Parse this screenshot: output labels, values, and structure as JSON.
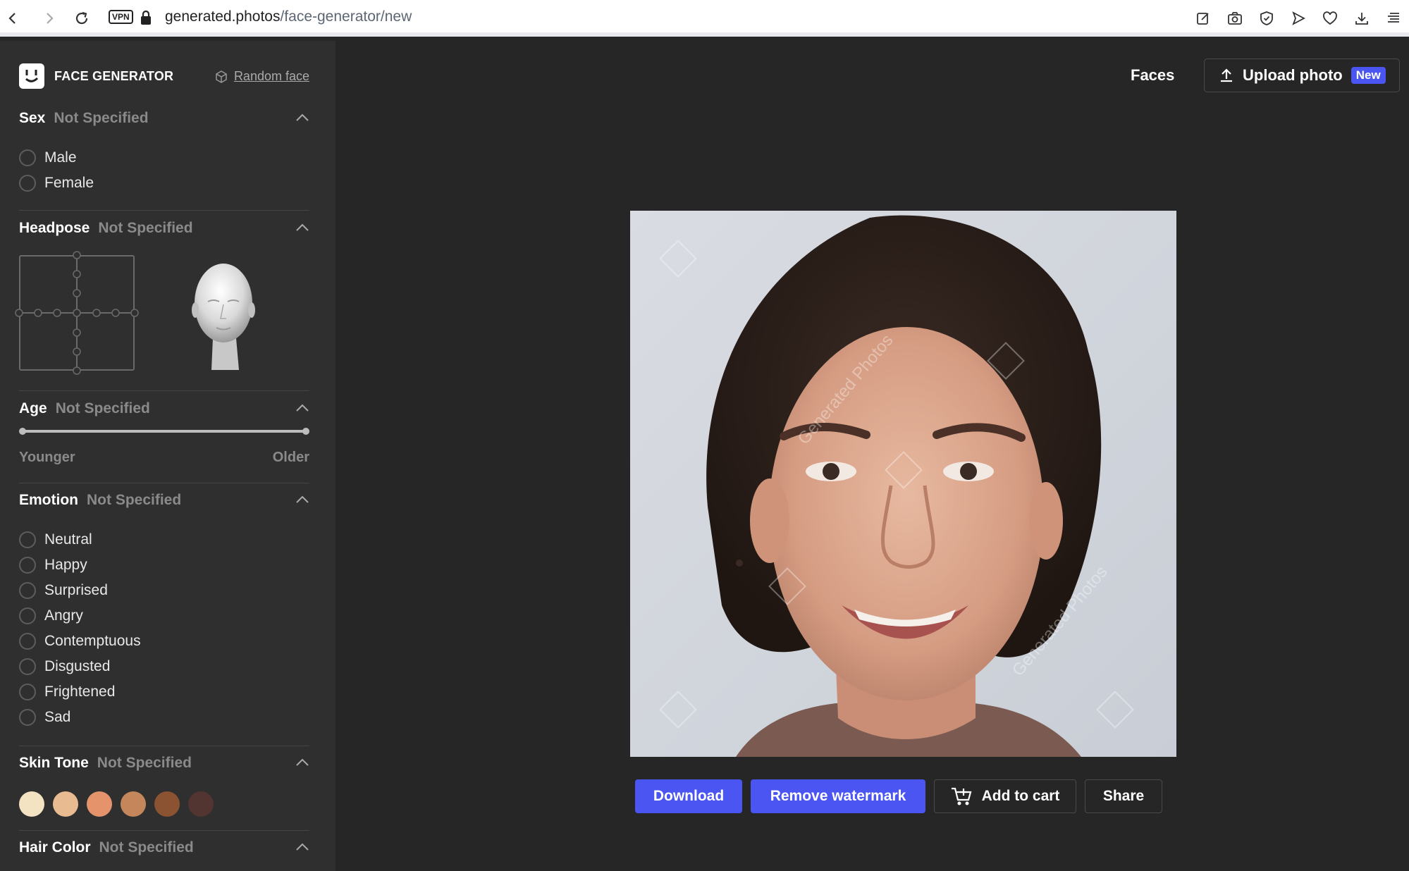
{
  "browser": {
    "url_host": "generated.photos",
    "url_path": "/face-generator/new",
    "vpn_label": "VPN"
  },
  "sidebar": {
    "logo_text": "FACE GENERATOR",
    "random_face_label": "Random face",
    "sex": {
      "title": "Sex",
      "value": "Not Specified",
      "options": [
        "Male",
        "Female"
      ]
    },
    "headpose": {
      "title": "Headpose",
      "value": "Not Specified"
    },
    "age": {
      "title": "Age",
      "value": "Not Specified",
      "min_label": "Younger",
      "max_label": "Older"
    },
    "emotion": {
      "title": "Emotion",
      "value": "Not Specified",
      "options": [
        "Neutral",
        "Happy",
        "Surprised",
        "Angry",
        "Contemptuous",
        "Disgusted",
        "Frightened",
        "Sad"
      ]
    },
    "skin_tone": {
      "title": "Skin Tone",
      "value": "Not Specified",
      "colors": [
        "#f3e3c3",
        "#e9bb90",
        "#e5936b",
        "#c4865a",
        "#8b5331",
        "#523530"
      ]
    },
    "hair_color": {
      "title": "Hair Color",
      "value": "Not Specified"
    }
  },
  "main": {
    "faces_link": "Faces",
    "upload_label": "Upload photo",
    "new_badge": "New",
    "watermark_text": "Generated Photos",
    "buttons": {
      "download": "Download",
      "remove_watermark": "Remove watermark",
      "add_to_cart": "Add to cart",
      "share": "Share"
    }
  },
  "colors": {
    "accent": "#4b56f2",
    "sidebar_bg": "#2f2f2f",
    "main_bg": "#262626"
  }
}
